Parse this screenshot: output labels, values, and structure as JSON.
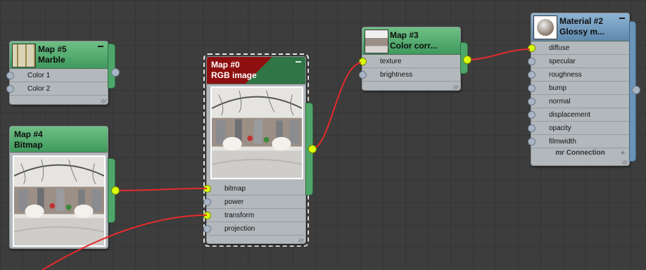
{
  "nodes": {
    "map5": {
      "title": "Map #5",
      "subtitle": "Marble",
      "thumb_icon": "marble-thumbnail",
      "slots": [
        "Color 1",
        "Color 2"
      ]
    },
    "map4": {
      "title": "Map #4",
      "subtitle": "Bitmap",
      "preview_icon": "panorama-room-image"
    },
    "map0": {
      "title": "Map #0",
      "subtitle": "RGB image",
      "preview_icon": "panorama-room-image",
      "slots": [
        "bitmap",
        "power",
        "transform",
        "projection"
      ]
    },
    "map3": {
      "title": "Map #3",
      "subtitle": "Color corr...",
      "thumb_icon": "panorama-thumbnail",
      "slots": [
        "texture",
        "brightness"
      ]
    },
    "mat2": {
      "title": "Material #2",
      "subtitle": "Glossy m...",
      "thumb_icon": "sphere-thumbnail",
      "slots": [
        "diffuse",
        "specular",
        "roughness",
        "bump",
        "normal",
        "displacement",
        "opacity",
        "filmwidth"
      ],
      "footer": "mr Connection",
      "footer_plus": "+"
    }
  },
  "colors": {
    "header_green": "#4ea66a",
    "header_blue": "#6c93b8",
    "header_selected_red": "#8e0f0f",
    "port_connected": "#d9ff0c",
    "port_empty": "#a8b5c4",
    "wire": "#e52b2b",
    "canvas": "#3d3d3d"
  }
}
